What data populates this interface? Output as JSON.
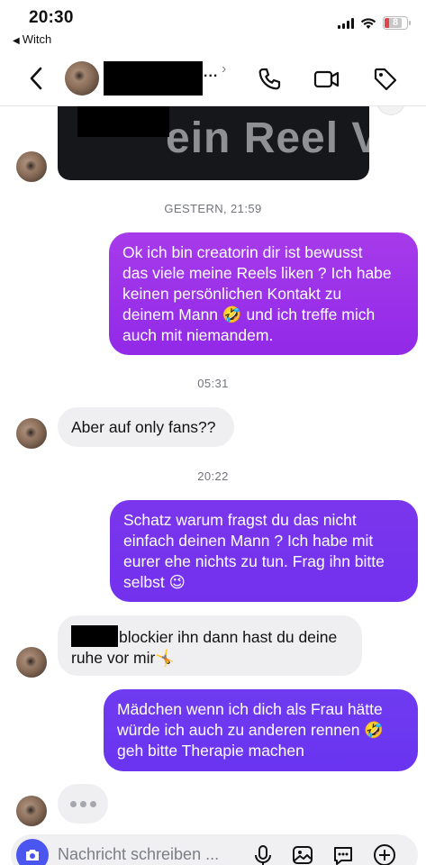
{
  "status_bar": {
    "time": "20:30",
    "back_app": "Witch",
    "battery": "8"
  },
  "header": {
    "ellipsis": "...",
    "chevron": "›"
  },
  "reel": {
    "text": "ein Reel V"
  },
  "messages": [
    {
      "type": "timestamp",
      "text": "GESTERN, 21:59"
    },
    {
      "type": "outgoing",
      "lines": [
        "Ok ich bin creatorin dir ist bewusst",
        "das viele meine Reels liken ? Ich habe",
        "keinen persönlichen Kontakt zu",
        "deinem Mann 🤣 und ich treffe mich",
        "auch mit niemandem."
      ]
    },
    {
      "type": "timestamp",
      "text": "05:31"
    },
    {
      "type": "incoming",
      "lines": [
        "Aber auf only fans??"
      ]
    },
    {
      "type": "timestamp",
      "text": "20:22"
    },
    {
      "type": "outgoing",
      "lines": [
        "Schatz warum fragst du das nicht",
        "einfach deinen Mann ? Ich habe mit",
        "eurer ehe nichts zu tun. Frag ihn bitte",
        "selbst 😉"
      ]
    },
    {
      "type": "incoming",
      "lines": [
        "blockier ihn dann hast du deine",
        "ruhe vor mir🤸"
      ]
    },
    {
      "type": "outgoing",
      "lines": [
        "Mädchen wenn ich dich als Frau hätte",
        "würde ich auch zu anderen rennen 🤣",
        "geh bitte Therapie machen"
      ]
    }
  ],
  "composer": {
    "placeholder": "Nachricht schreiben ..."
  },
  "colors": {
    "bubble_purple": "#9c33e9",
    "bubble_violet": "#7434ee",
    "incoming_bg": "#efeff2",
    "camera_button": "#4b56f0"
  },
  "icons": [
    "back-icon",
    "phone-icon",
    "video-icon",
    "tag-icon",
    "camera-icon",
    "microphone-icon",
    "gallery-icon",
    "sticker-icon",
    "plus-icon"
  ]
}
